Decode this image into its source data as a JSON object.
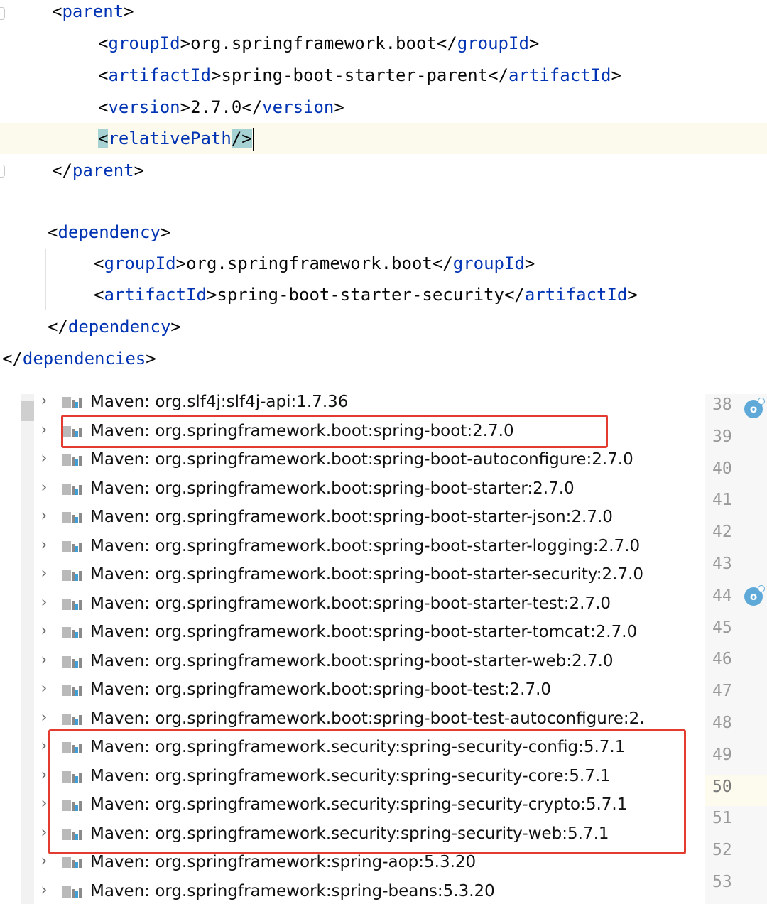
{
  "code": {
    "parent_open": "parent",
    "groupId_tag": "groupId",
    "group_value": "org.springframework.boot",
    "artifactId_tag": "artifactId",
    "parent_artifact_value": "spring-boot-starter-parent",
    "version_tag": "version",
    "version_value": "2.7.0",
    "relativePath_tag": "relativePath",
    "dependency_tag": "dependency",
    "dep_group_value": "org.springframework.boot",
    "dep_artifact_value": "spring-boot-starter-security",
    "dependencies_tag": "dependencies"
  },
  "tree": {
    "items": [
      {
        "label": "Maven: org.slf4j:slf4j-api:1.7.36",
        "clipped": true
      },
      {
        "label": "Maven: org.springframework.boot:spring-boot:2.7.0"
      },
      {
        "label": "Maven: org.springframework.boot:spring-boot-autoconfigure:2.7.0"
      },
      {
        "label": "Maven: org.springframework.boot:spring-boot-starter:2.7.0"
      },
      {
        "label": "Maven: org.springframework.boot:spring-boot-starter-json:2.7.0"
      },
      {
        "label": "Maven: org.springframework.boot:spring-boot-starter-logging:2.7.0"
      },
      {
        "label": "Maven: org.springframework.boot:spring-boot-starter-security:2.7.0"
      },
      {
        "label": "Maven: org.springframework.boot:spring-boot-starter-test:2.7.0"
      },
      {
        "label": "Maven: org.springframework.boot:spring-boot-starter-tomcat:2.7.0"
      },
      {
        "label": "Maven: org.springframework.boot:spring-boot-starter-web:2.7.0"
      },
      {
        "label": "Maven: org.springframework.boot:spring-boot-test:2.7.0"
      },
      {
        "label": "Maven: org.springframework.boot:spring-boot-test-autoconfigure:2."
      },
      {
        "label": "Maven: org.springframework.security:spring-security-config:5.7.1"
      },
      {
        "label": "Maven: org.springframework.security:spring-security-core:5.7.1"
      },
      {
        "label": "Maven: org.springframework.security:spring-security-crypto:5.7.1"
      },
      {
        "label": "Maven: org.springframework.security:spring-security-web:5.7.1"
      },
      {
        "label": "Maven: org.springframework:spring-aop:5.3.20"
      },
      {
        "label": "Maven: org.springframework:spring-beans:5.3.20"
      }
    ],
    "chevron": "›",
    "icon": "maven-library-icon"
  },
  "gutter": {
    "line_numbers": [
      "38",
      "39",
      "40",
      "41",
      "42",
      "43",
      "44",
      "45",
      "46",
      "47",
      "48",
      "49",
      "50",
      "51",
      "52",
      "53"
    ],
    "current_line": "50",
    "icon_glyph": "o"
  },
  "colors": {
    "tag": "#0033b3",
    "highlight_box": "#e33b30",
    "bracket_match": "#a6d2d4"
  }
}
